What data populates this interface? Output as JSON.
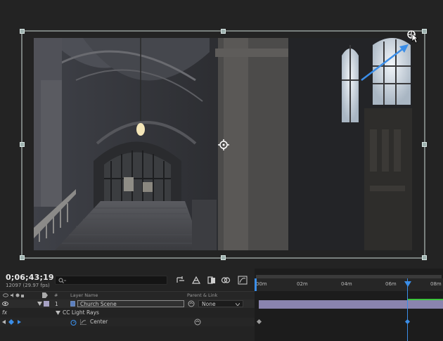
{
  "composition_viewer": {
    "image_description_icon": "cathedral-stairs-footage",
    "anchor_icon": "anchor-point-icon",
    "effect_point_icon": "effect-center-point-icon",
    "cursor_icon": "cursor-arrow-icon"
  },
  "timeline": {
    "current_time": "0;06;43;19",
    "frame_info": "12097 (29.97 fps)",
    "search_placeholder": "",
    "columns": {
      "number": "#",
      "layer_name": "Layer Name",
      "parent_link": "Parent & Link"
    },
    "layers": [
      {
        "index": "1",
        "name": "Church Scene",
        "parent": "None",
        "label_color": "#a7a2c4"
      }
    ],
    "effect": {
      "name": "CC Light Rays",
      "fx_label": "fx",
      "property": "Center"
    },
    "ruler_ticks": [
      "00m",
      "02m",
      "04m",
      "06m",
      "08m"
    ],
    "colors": {
      "cti": "#3b8ee8",
      "layer_bar": "#8a84ae",
      "accent_blue": "#3b8ee8"
    }
  }
}
